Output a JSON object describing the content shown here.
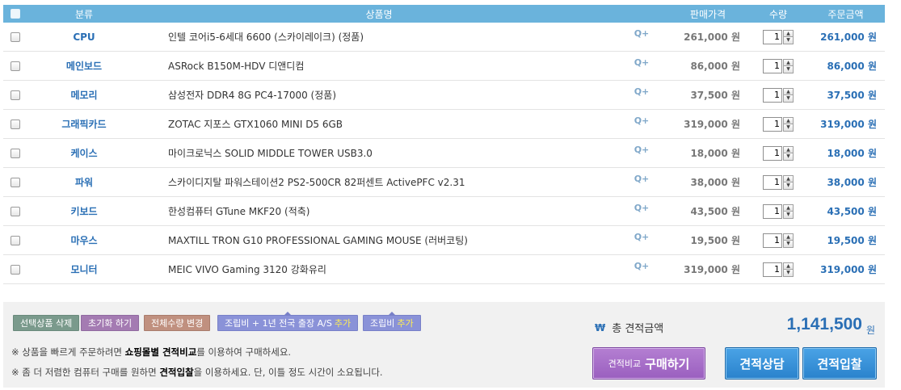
{
  "header": {
    "category": "분류",
    "product": "상품명",
    "price": "판매가격",
    "qty": "수량",
    "total": "주문금액"
  },
  "unit": "원",
  "quick_view_label": "Q+",
  "rows": [
    {
      "category": "CPU",
      "name": "인텔 코어i5-6세대 6600 (스카이레이크) (정품)",
      "price": "261,000",
      "qty": "1",
      "total": "261,000"
    },
    {
      "category": "메인보드",
      "name": "ASRock B150M-HDV 디앤디컴",
      "price": "86,000",
      "qty": "1",
      "total": "86,000"
    },
    {
      "category": "메모리",
      "name": "삼성전자 DDR4 8G PC4-17000 (정품)",
      "price": "37,500",
      "qty": "1",
      "total": "37,500"
    },
    {
      "category": "그래픽카드",
      "name": "ZOTAC 지포스 GTX1060 MINI D5 6GB",
      "price": "319,000",
      "qty": "1",
      "total": "319,000"
    },
    {
      "category": "케이스",
      "name": "마이크로닉스 SOLID MIDDLE TOWER USB3.0",
      "price": "18,000",
      "qty": "1",
      "total": "18,000"
    },
    {
      "category": "파워",
      "name": "스카이디지탈 파워스테이션2 PS2-500CR 82퍼센트 ActivePFC v2.31",
      "price": "38,000",
      "qty": "1",
      "total": "38,000"
    },
    {
      "category": "키보드",
      "name": "한성컴퓨터 GTune MKF20 (적축)",
      "price": "43,500",
      "qty": "1",
      "total": "43,500"
    },
    {
      "category": "마우스",
      "name": "MAXTILL TRON G10 PROFESSIONAL GAMING MOUSE (러버코팅)",
      "price": "19,500",
      "qty": "1",
      "total": "19,500"
    },
    {
      "category": "모니터",
      "name": "MEIC VIVO Gaming 3120 강화유리",
      "price": "319,000",
      "qty": "1",
      "total": "319,000"
    }
  ],
  "actions": {
    "delete_selected": "선택상품 삭제",
    "reset": "초기화 하기",
    "change_all_qty": "전체수량 변경",
    "assembly_as": "조립비 + 1년 전국 출장 A/S",
    "assembly": "조립비",
    "add": "추가"
  },
  "notes": {
    "note1_prefix": "※ 상품을 빠르게 주문하려면 ",
    "note1_bold": "쇼핑몰별 견적비교",
    "note1_suffix": "를 이용하여 구매하세요.",
    "note2_prefix": "※ 좀 더 저렴한 컴퓨터 구매를 원하면 ",
    "note2_bold": "견적입찰",
    "note2_suffix": "을 이용하세요. 단, 이틀 정도 시간이 소요됩니다."
  },
  "summary": {
    "currency_symbol": "₩",
    "total_label": "총 견적금액",
    "total_value": "1,141,500"
  },
  "buttons": {
    "buy_small": "견적비교",
    "buy_big": "구매하기",
    "consult": "견적상담",
    "bid": "견적입찰"
  },
  "colors": {
    "header_bg": "#6ab3dc",
    "accent_blue": "#2a6fb5",
    "buy_purple": "#9a5fbf",
    "action_blue": "#2a82cc"
  }
}
